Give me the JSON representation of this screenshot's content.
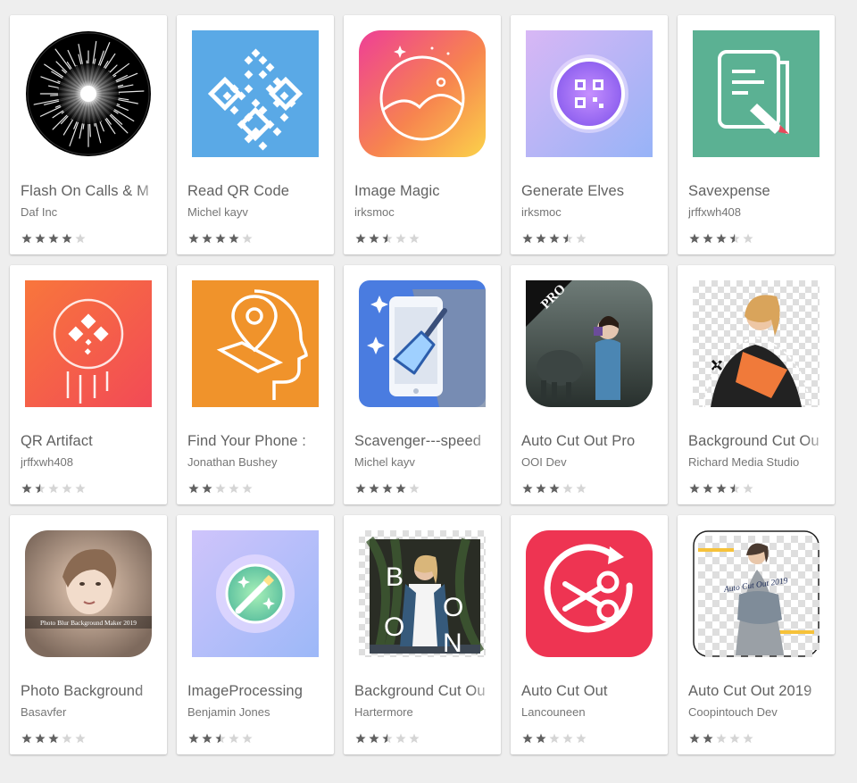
{
  "apps": [
    {
      "title": "Flash On Calls & M",
      "developer": "Daf Inc",
      "rating": 4,
      "icon": "flash-burst-icon"
    },
    {
      "title": "Read QR Code",
      "developer": "Michel kayv",
      "rating": 4,
      "icon": "qr-code-icon"
    },
    {
      "title": "Image Magic",
      "developer": "irksmoc",
      "rating": 2.5,
      "icon": "landscape-circle-icon"
    },
    {
      "title": "Generate Elves",
      "developer": "irksmoc",
      "rating": 3.5,
      "icon": "qr-orb-icon"
    },
    {
      "title": "Savexpense",
      "developer": "jrffxwh408",
      "rating": 3.5,
      "icon": "document-pen-icon"
    },
    {
      "title": "QR Artifact",
      "developer": "jrffxwh408",
      "rating": 1.5,
      "icon": "qr-circle-icon"
    },
    {
      "title": "Find Your Phone :",
      "developer": "Jonathan Bushey",
      "rating": 2,
      "icon": "head-location-pin-icon"
    },
    {
      "title": "Scavenger---speed",
      "developer": "Michel kayv",
      "rating": 4,
      "icon": "phone-broom-icon"
    },
    {
      "title": "Auto Cut Out Pro",
      "developer": "OOI Dev",
      "rating": 3,
      "icon": "photo-cutout-pro-icon"
    },
    {
      "title": "Background Cut Ou",
      "developer": "Richard Media Studio",
      "rating": 3.5,
      "icon": "woman-cutout-icon"
    },
    {
      "title": "Photo Background",
      "developer": "Basavfer",
      "rating": 3,
      "icon": "blurred-portrait-icon",
      "icon_caption": "Photo Blur Background Maker 2019"
    },
    {
      "title": "ImageProcessing",
      "developer": "Benjamin Jones",
      "rating": 2.5,
      "icon": "magic-wand-icon"
    },
    {
      "title": "Background Cut Ou",
      "developer": "Hartermore",
      "rating": 2.5,
      "icon": "boon-photo-icon",
      "icon_letters": [
        "B",
        "O",
        "O",
        "N"
      ]
    },
    {
      "title": "Auto Cut Out",
      "developer": "Lancouneen",
      "rating": 2,
      "icon": "scissors-circle-icon"
    },
    {
      "title": "Auto Cut Out 2019",
      "developer": "Coopintouch Dev",
      "rating": 2,
      "icon": "auto-cut-out-photo-icon",
      "icon_caption": "Auto Cut Out 2019"
    }
  ],
  "colors": {
    "star_filled": "#616161",
    "star_empty": "#d5d5d5",
    "title_text": "#616161",
    "developer_text": "#757575"
  }
}
